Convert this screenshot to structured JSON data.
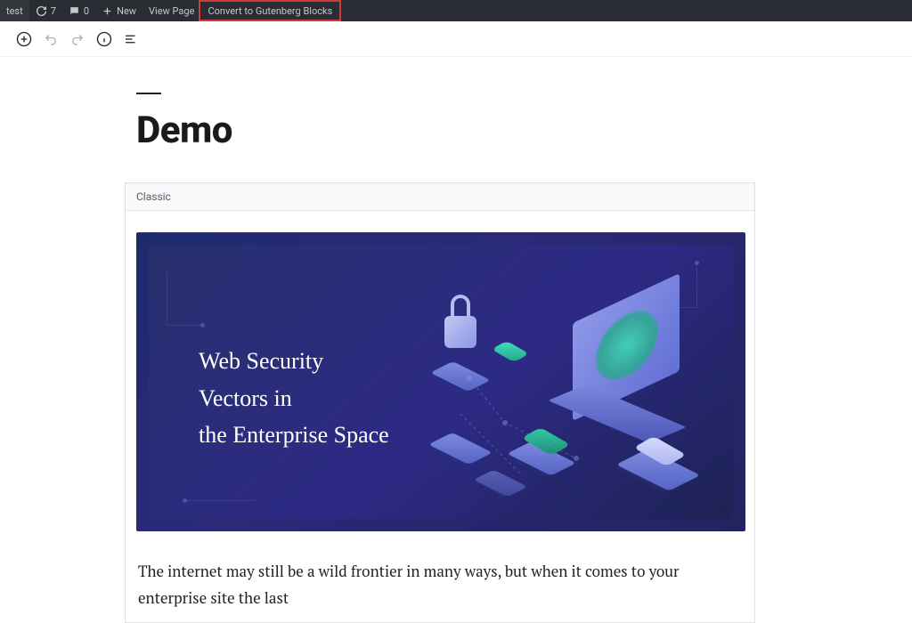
{
  "adminbar": {
    "site_name_fragment": "test",
    "updates_count": "7",
    "comments_count": "0",
    "new_label": "New",
    "view_page_label": "View Page",
    "convert_label": "Convert to Gutenberg Blocks"
  },
  "editor": {
    "title": "Demo",
    "block_label": "Classic"
  },
  "hero": {
    "line1": "Web Security",
    "line2": "Vectors in",
    "line3": "the Enterprise Space"
  },
  "article": {
    "paragraph": "The internet may still be a wild frontier in many ways, but when it comes to your enterprise site the last"
  }
}
